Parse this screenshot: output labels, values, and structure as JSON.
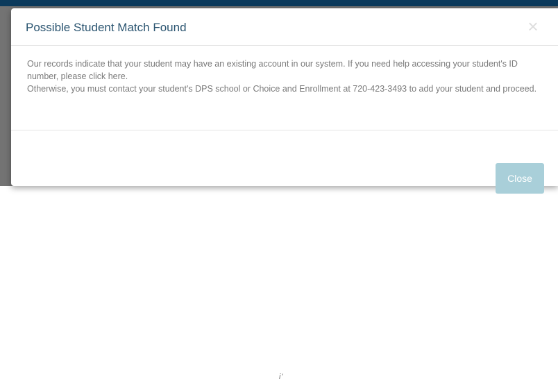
{
  "modal": {
    "title": "Possible Student Match Found",
    "close_icon": "close-icon",
    "close_glyph": "×",
    "body_line_1": "Our records indicate that your student may have an existing account in our system. If you need help accessing your student's ID number, please click here.",
    "body_line_2": "Otherwise, you must contact your student's DPS school or Choice and Enrollment at 720-423-3493 to add your student and proceed.",
    "close_button_label": "Close"
  },
  "background": {
    "stray_text": "i'"
  },
  "colors": {
    "topbar": "#0b3a5c",
    "title": "#2a5470",
    "body_text": "#7a7a7a",
    "close_button": "#a9cfd9",
    "overlay": "#737373"
  }
}
